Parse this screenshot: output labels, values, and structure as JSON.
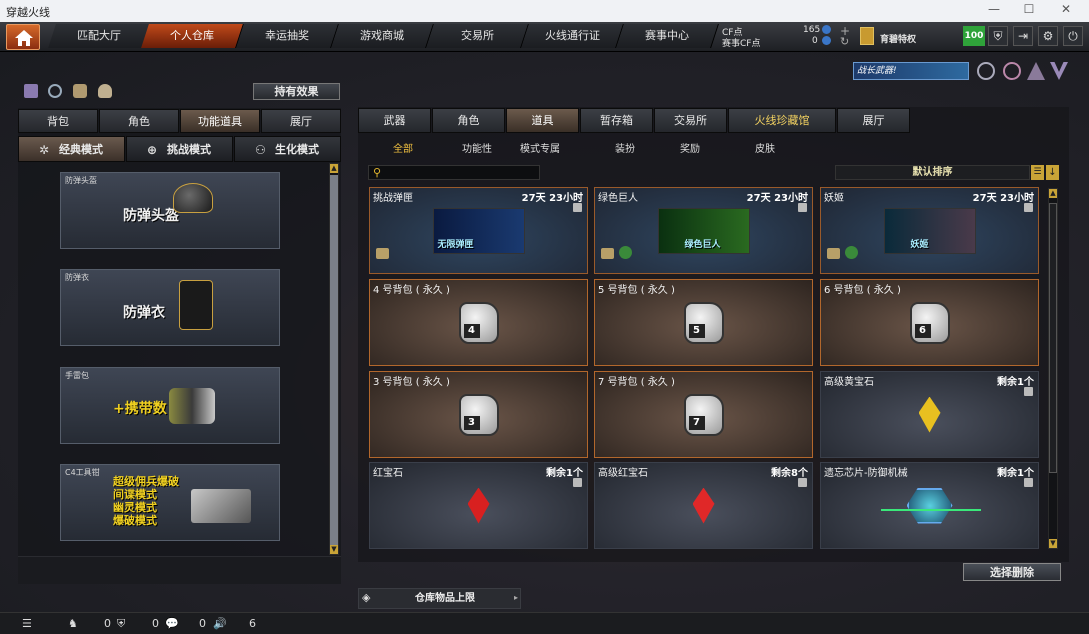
{
  "window": {
    "title": "穿越火线"
  },
  "nav": {
    "tabs": [
      "匹配大厅",
      "个人仓库",
      "幸运抽奖",
      "游戏商城",
      "交易所",
      "火线通行证",
      "赛事中心"
    ],
    "active": 1
  },
  "currency": {
    "cf_label": "CF点",
    "cf_value": "165",
    "match_label": "赛事CF点",
    "match_value": "0",
    "privilege": "育碧特权",
    "level": "100"
  },
  "effect_button": "持有效果",
  "left_tabs": [
    "背包",
    "角色",
    "功能道具",
    "展厅"
  ],
  "left_active": 2,
  "modes": [
    "经典模式",
    "挑战模式",
    "生化模式"
  ],
  "slots": [
    {
      "label": "防弹头盔",
      "title": "防弹头盔"
    },
    {
      "label": "防弹衣",
      "title": "防弹衣"
    },
    {
      "label": "手雷包",
      "title": "+携带数"
    },
    {
      "label": "C4工具钳",
      "lines": [
        "超级佣兵爆破",
        "间谍模式",
        "幽灵模式",
        "爆破模式"
      ]
    }
  ],
  "banner": "战长武器!",
  "right_tabs": [
    "武器",
    "角色",
    "道具",
    "暂存箱",
    "交易所",
    "火线珍藏馆",
    "展厅"
  ],
  "right_active": 2,
  "sub_tabs": [
    "全部",
    "功能性",
    "模式专属",
    "装扮",
    "奖励",
    "皮肤"
  ],
  "sub_active": 0,
  "sort_label": "默认排序",
  "items": [
    {
      "name": "挑战弹匣",
      "right": "27天 23小时",
      "kind": "timed",
      "art": "无限弹匣"
    },
    {
      "name": "绿色巨人",
      "right": "27天 23小时",
      "kind": "timed",
      "art": "绿色巨人"
    },
    {
      "name": "妖姬",
      "right": "27天 23小时",
      "kind": "timed",
      "art": "妖姬"
    },
    {
      "name": "4 号背包 ( 永久 )",
      "right": "",
      "kind": "bag",
      "num": "4"
    },
    {
      "name": "5 号背包 ( 永久 )",
      "right": "",
      "kind": "bag",
      "num": "5"
    },
    {
      "name": "6 号背包 ( 永久 )",
      "right": "",
      "kind": "bag",
      "num": "6"
    },
    {
      "name": "3 号背包 ( 永久 )",
      "right": "",
      "kind": "bag",
      "num": "3"
    },
    {
      "name": "7 号背包 ( 永久 )",
      "right": "",
      "kind": "bag",
      "num": "7"
    },
    {
      "name": "高级黄宝石",
      "right": "剩余1个",
      "kind": "gem",
      "color": "#e8c020"
    },
    {
      "name": "红宝石",
      "right": "剩余1个",
      "kind": "gem",
      "color": "#d82020"
    },
    {
      "name": "高级红宝石",
      "right": "剩余8个",
      "kind": "gem",
      "color": "#e02828"
    },
    {
      "name": "遗忘芯片-防御机械",
      "right": "剩余1个",
      "kind": "chip"
    }
  ],
  "select_delete": "选择删除",
  "storage_limit": "仓库物品上限",
  "status": {
    "a": "0",
    "b": "0",
    "c": "0",
    "d": "6"
  }
}
